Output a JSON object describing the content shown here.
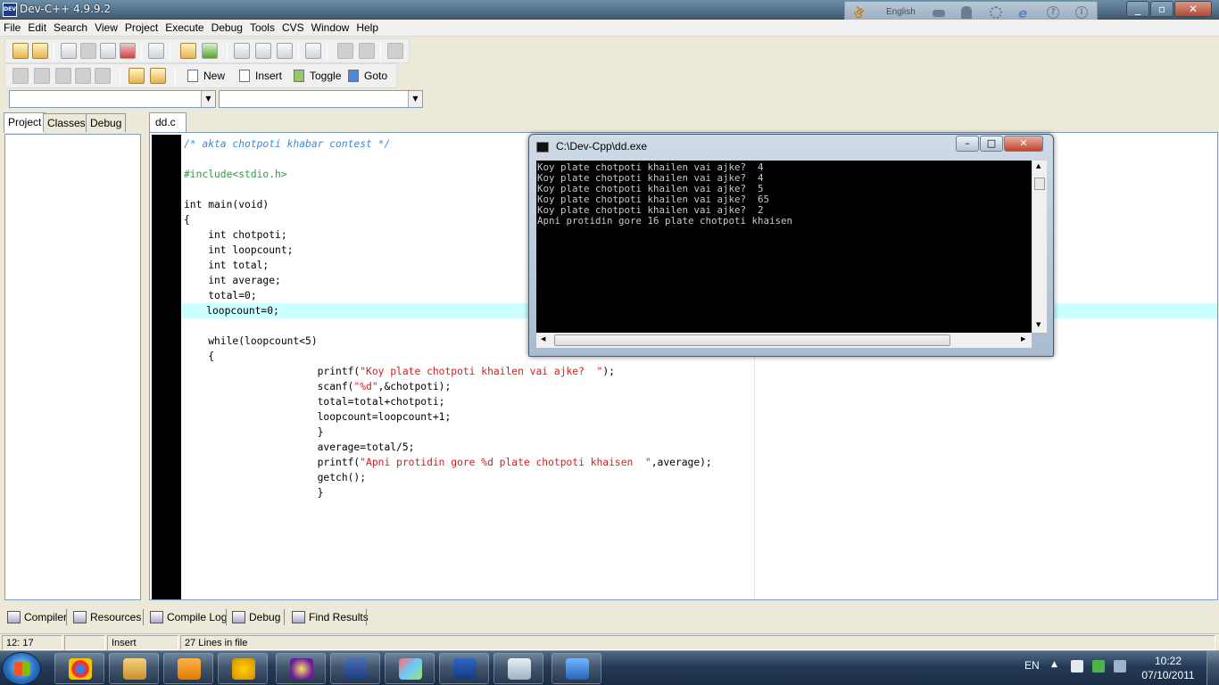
{
  "window": {
    "title": "Dev-C++ 4.9.9.2",
    "icon_label": "DEV"
  },
  "language_bar": {
    "label": "English"
  },
  "menu": [
    "File",
    "Edit",
    "Search",
    "View",
    "Project",
    "Execute",
    "Debug",
    "Tools",
    "CVS",
    "Window",
    "Help"
  ],
  "toolbar2": {
    "new_label": "New",
    "insert_label": "Insert",
    "toggle_label": "Toggle",
    "goto_label": "Goto"
  },
  "left_tabs": [
    "Project",
    "Classes",
    "Debug"
  ],
  "editor": {
    "file_tab": "dd.c",
    "lines": [
      {
        "text": "/* akta chotpoti khabar contest */",
        "kind": "comment"
      },
      {
        "text": "",
        "kind": "code"
      },
      {
        "text": "#include<stdio.h>",
        "kind": "preproc"
      },
      {
        "text": "",
        "kind": "code"
      },
      {
        "text": "int main(void)",
        "kind": "code"
      },
      {
        "text": "{",
        "kind": "code"
      },
      {
        "text": "    int chotpoti;",
        "kind": "code"
      },
      {
        "text": "    int loopcount;",
        "kind": "code"
      },
      {
        "text": "    int total;",
        "kind": "code"
      },
      {
        "text": "    int average;",
        "kind": "code"
      },
      {
        "text": "    total=0;",
        "kind": "code"
      },
      {
        "text": "    loopcount=0;",
        "kind": "code",
        "highlight": true
      },
      {
        "text": "",
        "kind": "code"
      },
      {
        "text": "    while(loopcount<5)",
        "kind": "code"
      },
      {
        "text": "    {",
        "kind": "code"
      },
      {
        "pre": "                      printf(",
        "str": "\"Koy plate chotpoti khailen vai ajke?  \"",
        "post": ");",
        "kind": "mixed"
      },
      {
        "pre": "                      scanf(",
        "str": "\"%d\"",
        "post": ",&chotpoti);",
        "kind": "mixed"
      },
      {
        "text": "                      total=total+chotpoti;",
        "kind": "code"
      },
      {
        "text": "                      loopcount=loopcount+1;",
        "kind": "code"
      },
      {
        "text": "                      }",
        "kind": "code"
      },
      {
        "text": "                      average=total/5;",
        "kind": "code"
      },
      {
        "pre": "                      printf(",
        "str": "\"Apni protidin gore %d plate chotpoti khaisen  \"",
        "post": ",average);",
        "kind": "mixed"
      },
      {
        "text": "                      getch();",
        "kind": "code"
      },
      {
        "text": "                      }",
        "kind": "code"
      }
    ]
  },
  "console": {
    "title": "C:\\Dev-Cpp\\dd.exe",
    "lines": [
      "Koy plate chotpoti khailen vai ajke?  4",
      "Koy plate chotpoti khailen vai ajke?  4",
      "Koy plate chotpoti khailen vai ajke?  5",
      "Koy plate chotpoti khailen vai ajke?  65",
      "Koy plate chotpoti khailen vai ajke?  2",
      "Apni protidin gore 16 plate chotpoti khaisen"
    ]
  },
  "bottom_tabs": [
    "Compiler",
    "Resources",
    "Compile Log",
    "Debug",
    "Find Results"
  ],
  "status": {
    "position": "12: 17",
    "mode": "Insert",
    "lines": "27 Lines in file"
  },
  "taskbar": {
    "apps": [
      "chrome-icon",
      "explorer-icon",
      "media-player-icon",
      "transfer-icon",
      "yahoo-messenger-icon",
      "devcpp-icon",
      "paint-icon",
      "word-icon",
      "notepad-icon",
      "picture-viewer-icon"
    ],
    "lang": "EN",
    "time": "10:22",
    "date": "07/10/2011"
  }
}
